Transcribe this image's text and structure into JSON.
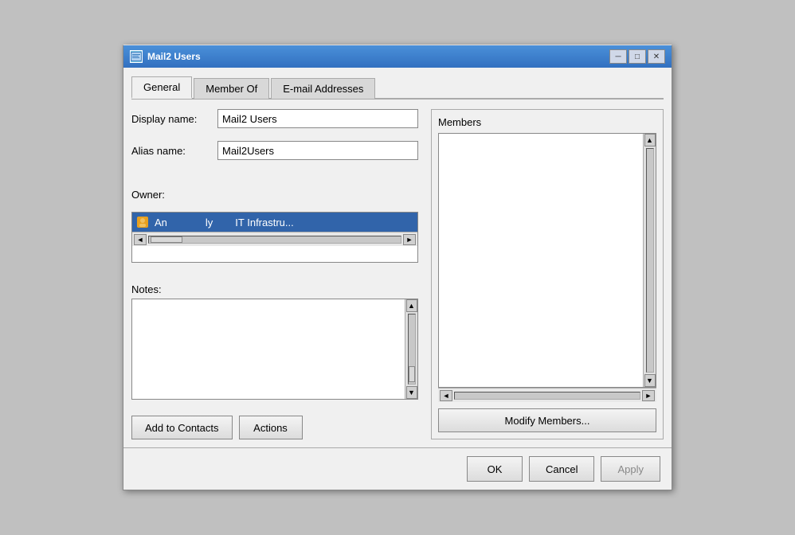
{
  "window": {
    "title": "Mail2 Users",
    "icon_label": "icon"
  },
  "title_buttons": {
    "minimize": "─",
    "maximize": "□",
    "close": "✕"
  },
  "tabs": [
    {
      "label": "General",
      "active": true
    },
    {
      "label": "Member Of",
      "active": false
    },
    {
      "label": "E-mail Addresses",
      "active": false
    }
  ],
  "form": {
    "display_name_label": "Display name:",
    "display_name_value": "Mail2 Users",
    "alias_name_label": "Alias name:",
    "alias_name_value": "Mail2Users",
    "owner_label": "Owner:",
    "owner_row_name": "An",
    "owner_row_col2": "ly",
    "owner_row_col3": "IT Infrastru...",
    "notes_label": "Notes:"
  },
  "buttons": {
    "add_to_contacts": "Add to Contacts",
    "actions": "Actions",
    "modify_members": "Modify Members..."
  },
  "members": {
    "title": "Members"
  },
  "footer": {
    "ok": "OK",
    "cancel": "Cancel",
    "apply": "Apply"
  }
}
